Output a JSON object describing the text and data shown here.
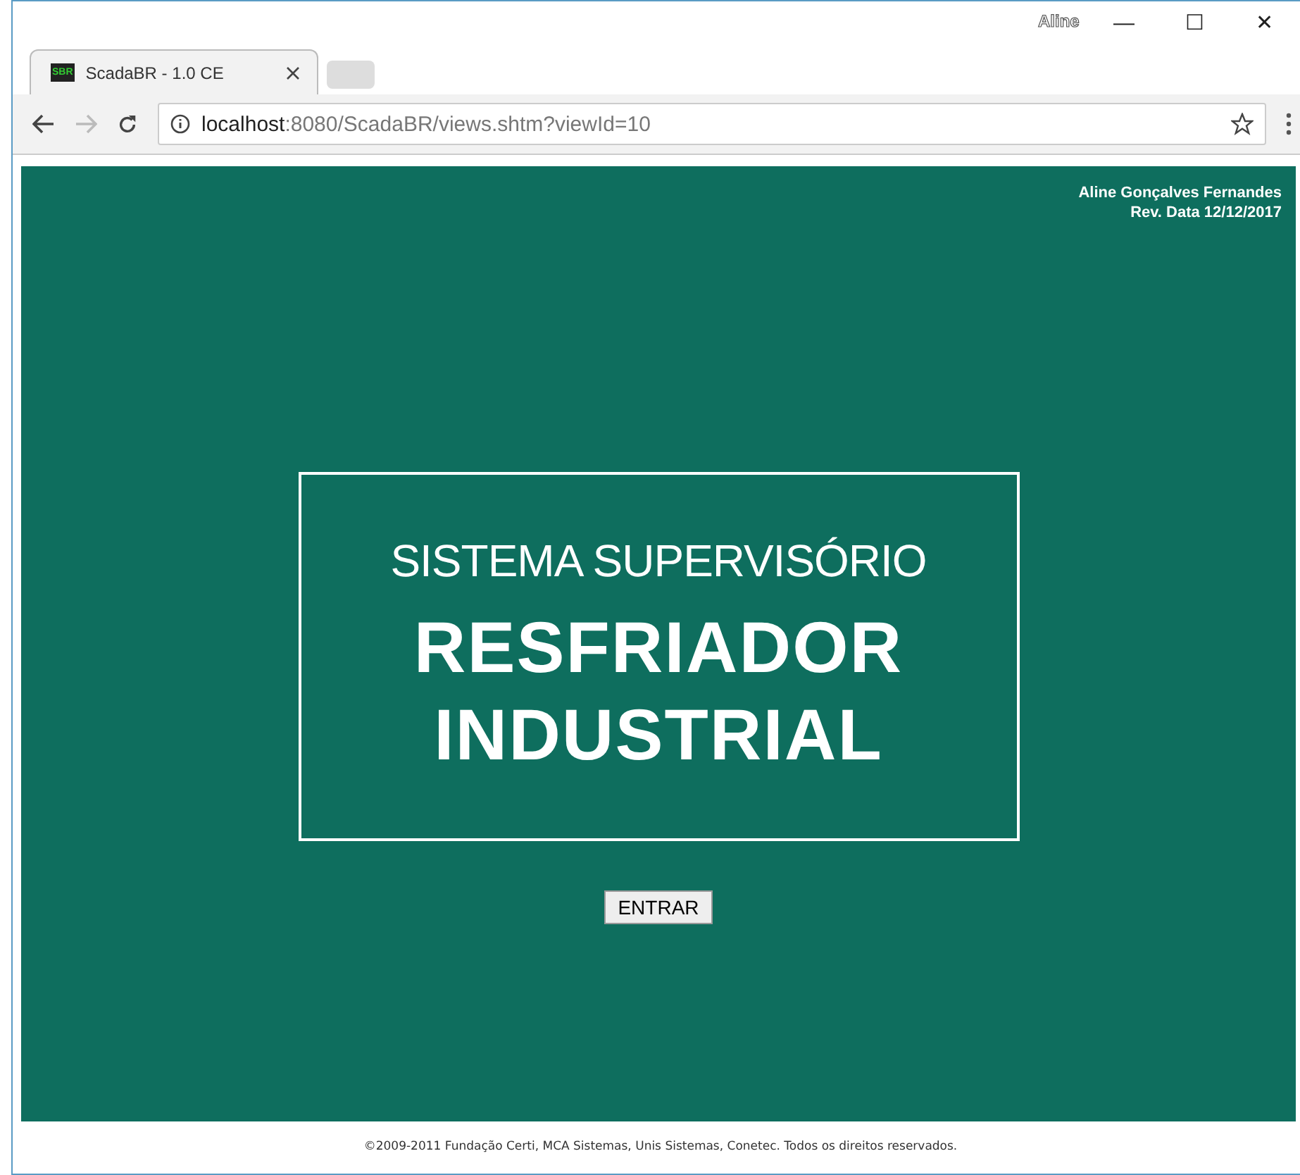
{
  "window": {
    "user": "Aline",
    "controls": [
      "—",
      "☐",
      "✕"
    ]
  },
  "tabs": [
    {
      "title": "ScadaBR - 1.0 CE",
      "favicon": "SBR",
      "selected": true
    }
  ],
  "address_bar": {
    "host": "localhost",
    "path": ":8080/ScadaBR/views.shtm?viewId=10"
  },
  "page": {
    "author": "Aline Gonçalves Fernandes",
    "revision": "Rev. Data 12/12/2017",
    "subtitle": "SISTEMA SUPERVISÓRIO",
    "title_lines": [
      "RESFRIADOR",
      "INDUSTRIAL"
    ],
    "button": "ENTRAR"
  },
  "footer": "©2009-2011 Fundação Certi, MCA Sistemas, Unis Sistemas, Conetec. Todos os direitos reservados."
}
